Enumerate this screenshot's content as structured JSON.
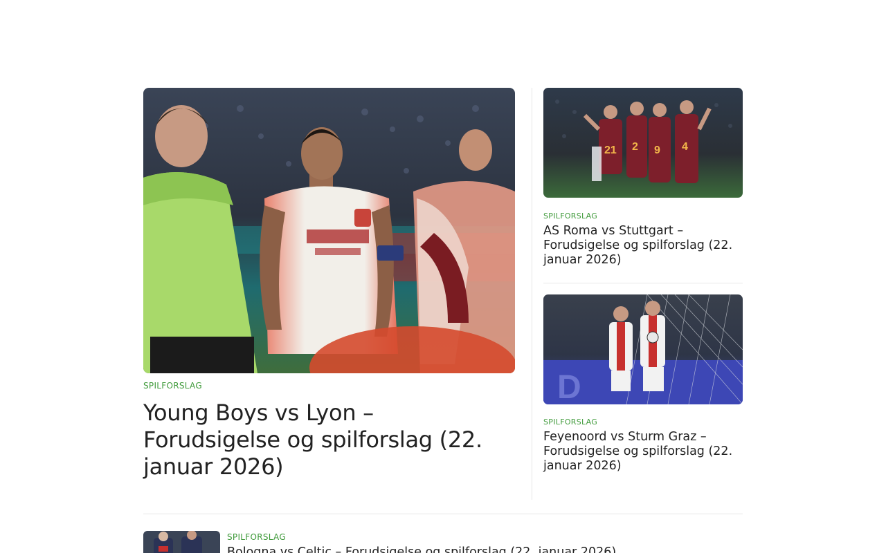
{
  "featured": {
    "category": "SPILFORSLAG",
    "title": "Young Boys vs Lyon – Forudsigelse og spilforslag (22. januar 2026)",
    "image_alt": "Young Boys vs Lyon"
  },
  "side_articles": [
    {
      "category": "SPILFORSLAG",
      "title": "AS Roma vs Stuttgart – Forudsigelse og spilforslag (22. januar 2026)",
      "image_alt": "AS Roma vs Stuttgart"
    },
    {
      "category": "SPILFORSLAG",
      "title": "Feyenoord vs Sturm Graz – Forudsigelse og spilforslag (22. januar 2026)",
      "image_alt": "Feyenoord vs Sturm Graz"
    }
  ],
  "list_articles": [
    {
      "category": "SPILFORSLAG",
      "title": "Bologna vs Celtic – Forudsigelse og spilforslag (22. januar 2026)",
      "image_alt": "Bologna vs Celtic"
    }
  ],
  "colors": {
    "category": "#3f9a3a",
    "title": "#222222",
    "divider": "#e6e6e6"
  }
}
